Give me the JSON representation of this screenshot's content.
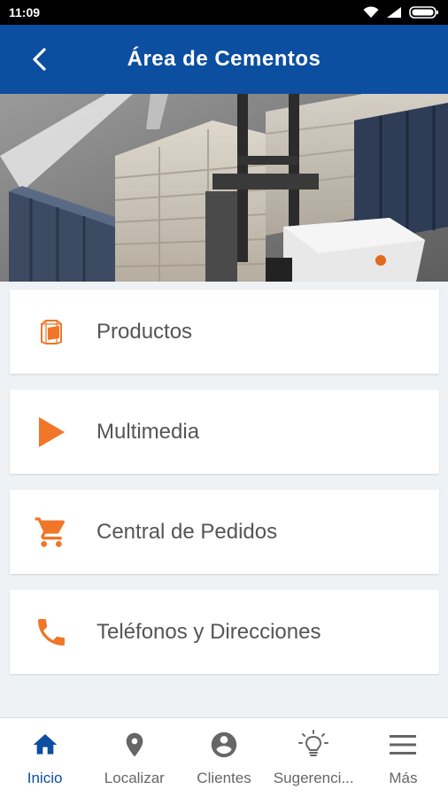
{
  "status_bar": {
    "time": "11:09"
  },
  "app_bar": {
    "title": "Área de Cementos"
  },
  "menu": {
    "items": [
      {
        "label": "Productos",
        "icon": "bag-icon"
      },
      {
        "label": "Multimedia",
        "icon": "play-icon"
      },
      {
        "label": "Central de Pedidos",
        "icon": "cart-icon"
      },
      {
        "label": "Teléfonos y Direcciones",
        "icon": "phone-icon"
      }
    ]
  },
  "bottom_nav": {
    "active": "Inicio",
    "items": [
      {
        "label": "Inicio",
        "icon": "home-icon"
      },
      {
        "label": "Localizar",
        "icon": "location-pin-icon"
      },
      {
        "label": "Clientes",
        "icon": "account-circle-icon"
      },
      {
        "label": "Sugerenci...",
        "icon": "lightbulb-icon"
      },
      {
        "label": "Más",
        "icon": "menu-icon"
      }
    ]
  },
  "colors": {
    "primary": "#0c4ea0",
    "accent": "#f07628",
    "inactive": "#666666"
  }
}
